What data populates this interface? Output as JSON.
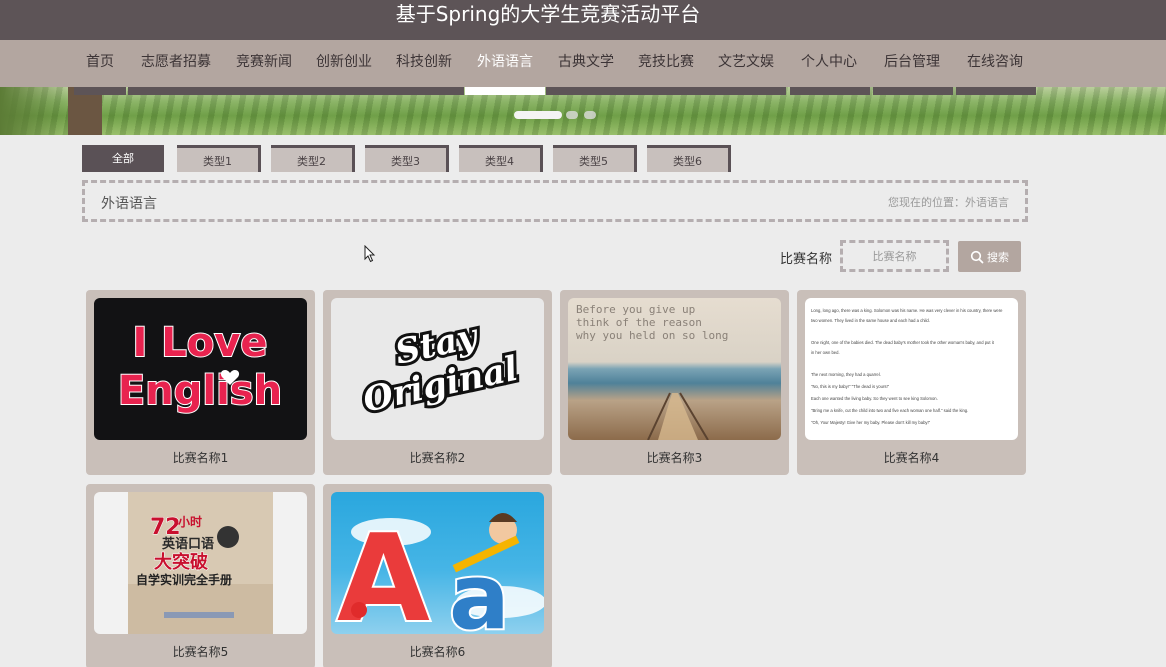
{
  "site": {
    "title": "基于Spring的大学生竞赛活动平台"
  },
  "nav": {
    "items": [
      {
        "label": "首页"
      },
      {
        "label": "志愿者招募"
      },
      {
        "label": "竞赛新闻"
      },
      {
        "label": "创新创业"
      },
      {
        "label": "科技创新"
      },
      {
        "label": "外语语言",
        "active": true
      },
      {
        "label": "古典文学"
      },
      {
        "label": "竞技比赛"
      },
      {
        "label": "文艺文娱"
      },
      {
        "label": "个人中心"
      },
      {
        "label": "后台管理"
      },
      {
        "label": "在线咨询"
      }
    ]
  },
  "categories": [
    {
      "label": "全部",
      "active": true
    },
    {
      "label": "类型1"
    },
    {
      "label": "类型2"
    },
    {
      "label": "类型3"
    },
    {
      "label": "类型4"
    },
    {
      "label": "类型5"
    },
    {
      "label": "类型6"
    }
  ],
  "breadcrumb": {
    "title": "外语语言",
    "location": "您现在的位置：外语语言"
  },
  "search": {
    "label": "比赛名称",
    "placeholder": "比赛名称",
    "button": "搜索"
  },
  "cards": [
    {
      "name": "比赛名称1",
      "image": {
        "line1": "I Love",
        "line2": "English"
      }
    },
    {
      "name": "比赛名称2",
      "image": {
        "line1": "Stay",
        "line2": "Original"
      }
    },
    {
      "name": "比赛名称3",
      "image": {
        "line1": "Before you give up",
        "line2": "think of the reason",
        "line3": "why you held on so long"
      }
    },
    {
      "name": "比赛名称4",
      "image": {
        "lines": [
          "Long, long ago, there was a king. Solomon was his name. He was very clever in his country, there were",
          "two women. They lived in the same house and each had a child.",
          "One night, one of the babies died. The dead baby's mother took the other woman's baby, and put it",
          "in her own bed.",
          "The next morning, they had a quarrel.",
          "\"No, this is my baby!\" \"The dead is yours!\"",
          "Each one wanted the living baby. So they went to see king Solomon.",
          "\"Bring me a knife, cut the child into two and five each woman one half.\" said the king.",
          "\"Oh, Your Majesty! Give her my baby. Please don't kill my baby!\""
        ]
      }
    },
    {
      "name": "比赛名称5",
      "image": {
        "line1": "72",
        "line2": "小时",
        "line3": "英语口语",
        "line4": "大突破",
        "line5": "自学实训完全手册"
      }
    },
    {
      "name": "比赛名称6",
      "image": {
        "line1": "A",
        "line2": "a"
      }
    }
  ],
  "colors": {
    "topbar": "#5d5457",
    "navbar": "#b3a6a0",
    "card": "#c9bfb9",
    "page": "#ececec"
  }
}
